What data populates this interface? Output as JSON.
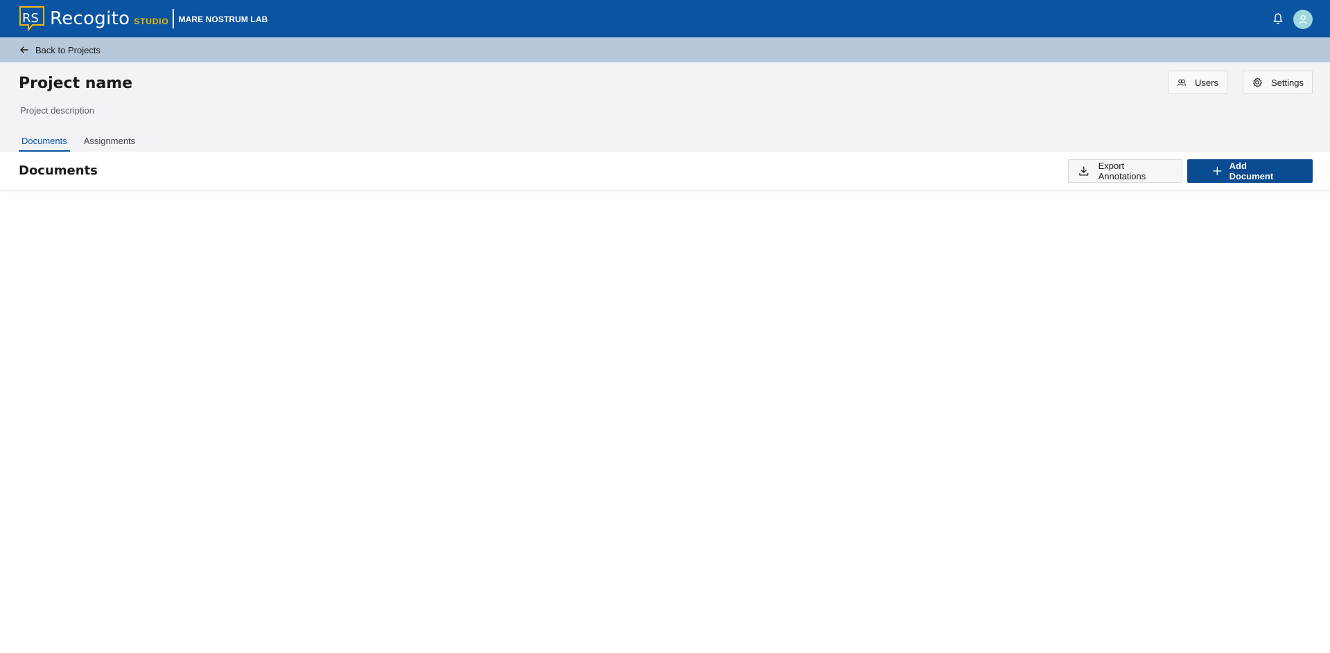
{
  "brand": {
    "name": "Recogito",
    "studio": "STUDIO",
    "org": "MARE NOSTRUM LAB",
    "logo_letters": "RS"
  },
  "topbar": {
    "notifications_icon": "bell-icon",
    "avatar_icon": "user-icon",
    "bg_color": "#0b54a1"
  },
  "nav": {
    "back_label": "Back to Projects",
    "back_icon": "arrow-left-icon"
  },
  "project": {
    "title": "Project name",
    "description": "Project description",
    "users_label": "Users",
    "settings_label": "Settings",
    "tabs": [
      {
        "label": "Documents",
        "active": true
      },
      {
        "label": "Assignments",
        "active": false
      }
    ]
  },
  "documents": {
    "heading": "Documents",
    "export_label": "Export Annotations",
    "add_label": "Add Document"
  },
  "colors": {
    "accent": "#0b54a1",
    "studio_accent": "#f2b705",
    "backbar": "#b7c8dd",
    "header_bg": "#f1f3f7"
  }
}
